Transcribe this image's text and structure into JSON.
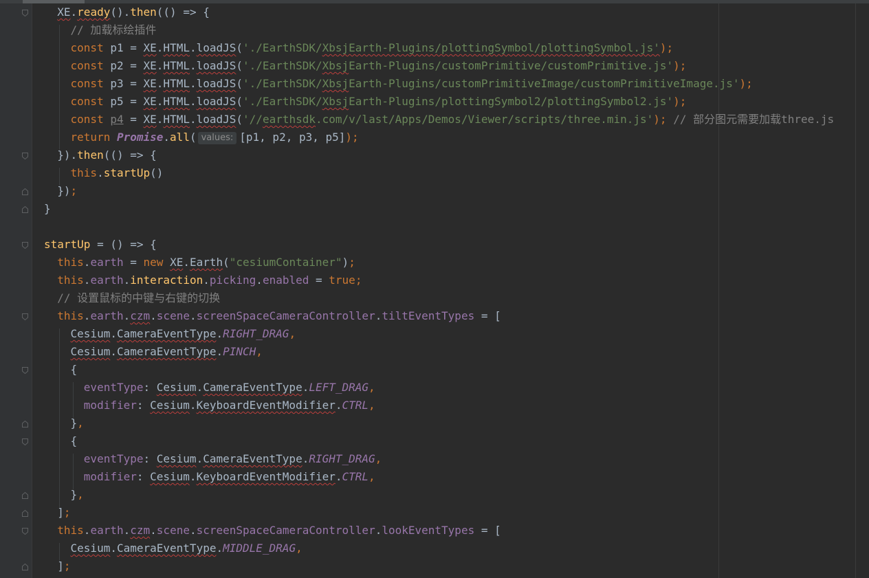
{
  "code": {
    "l1": {
      "xe": "XE",
      "ready": "ready",
      "then": "then"
    },
    "l2": {
      "comment": "// 加载标绘插件"
    },
    "l3": {
      "var": "p1",
      "path1": "'./EarthSDK/",
      "path2": "XbsjEarth-Plugins/plottingSymbol/plottingSymbol.js'"
    },
    "l4": {
      "var": "p2",
      "path1": "'./EarthSDK/",
      "path_u": "Xbsj",
      "path2": "Earth-Plugins/customPrimitive/customPrimitive.js'"
    },
    "l5": {
      "var": "p3",
      "path1": "'./EarthSDK/",
      "path_u": "Xbsj",
      "path2": "Earth-Plugins/customPrimitiveImage/customPrimitiveImage.js'"
    },
    "l6": {
      "var": "p5",
      "path1": "'./EarthSDK/",
      "path_u": "Xbsj",
      "path2": "Earth-Plugins/plottingSymbol2/plottingSymbol2.js'"
    },
    "l7": {
      "var": "p4",
      "path1": "'//",
      "path_u": "earthsdk",
      "path2": ".com/v/last/Apps/Demos/Viewer/scripts/three.min.js'",
      "comment": "// 部分图元需要加载three.js"
    },
    "l8": {
      "ret": "return",
      "promise": "Promise",
      "all": "all",
      "hint": "values:",
      "args": "[p1, p2, p3, p5]"
    },
    "l9": {
      "then": "then"
    },
    "l10": {
      "this": "this",
      "fn": "startUp"
    },
    "l13": {
      "name": "startUp"
    },
    "l14": {
      "earth": "earth",
      "cls": "Earth",
      "str": "\"cesiumContainer\""
    },
    "l15": {
      "earth": "earth",
      "interaction": "interaction",
      "picking": "picking",
      "enabled": "enabled",
      "val": "true"
    },
    "l16": {
      "comment": "// 设置鼠标的中键与右键的切换"
    },
    "l17": {
      "czm": "czm",
      "scene": "scene",
      "ctrl": "screenSpaceCameraController",
      "prop": "tiltEventTypes"
    },
    "l18": {
      "c": "RIGHT_DRAG"
    },
    "l19": {
      "c": "PINCH"
    },
    "l21": {
      "key": "eventType",
      "c": "LEFT_DRAG"
    },
    "l22": {
      "key": "modifier",
      "c": "CTRL"
    },
    "l25": {
      "key": "eventType",
      "c": "RIGHT_DRAG"
    },
    "l26": {
      "key": "modifier",
      "c": "CTRL"
    },
    "l29": {
      "prop": "lookEventTypes"
    },
    "l30": {
      "c": "MIDDLE_DRAG"
    }
  },
  "tokens": {
    "const": "const",
    "this": "this",
    "new": "new",
    "cesium": "Cesium",
    "cet": "CameraEventType",
    "kem": "KeyboardEventModifier",
    "html": "HTML",
    "loadjs": "loadJS"
  }
}
